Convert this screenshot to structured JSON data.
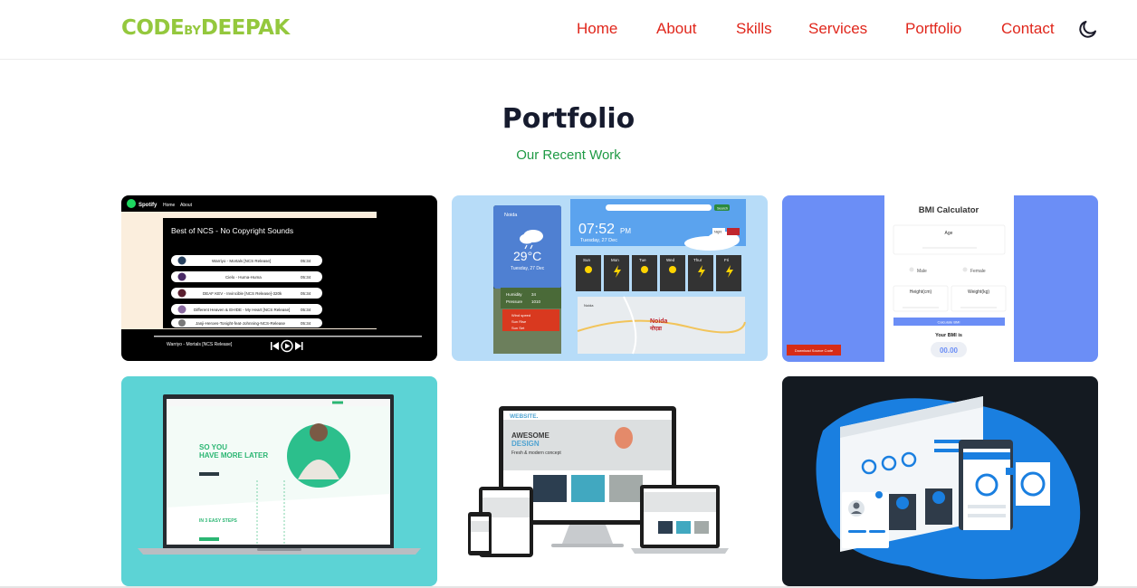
{
  "brand": {
    "code": "CODE",
    "by": "BY",
    "deepak": "DEEPAK"
  },
  "nav": [
    {
      "label": "Home"
    },
    {
      "label": "About"
    },
    {
      "label": "Skills"
    },
    {
      "label": "Services"
    },
    {
      "label": "Portfolio"
    },
    {
      "label": "Contact"
    }
  ],
  "theme_icon": "moon-icon",
  "section": {
    "title": "Portfolio",
    "subtitle": "Our Recent Work"
  },
  "colors": {
    "accent_green": "#94c83d",
    "nav_red": "#e0261b",
    "subtitle_green": "#1f9a45",
    "title": "#161b2e"
  },
  "projects": [
    {
      "name": "spotify-clone",
      "app": "Spotify",
      "menu": [
        "Home",
        "About"
      ],
      "playlist_title": "Best of NCS - No Copyright Sounds",
      "songs": [
        {
          "title": "Warriyo - Mortals [NCS Release]",
          "time": "05:34"
        },
        {
          "title": "Cielo - Huma-Huma",
          "time": "05:34"
        },
        {
          "title": "DEAF KEV - Invincible [NCS Release]-320k",
          "time": "05:34"
        },
        {
          "title": "Different Heaven & EH!DE - My Heart [NCS Release]",
          "time": "05:34"
        },
        {
          "title": "Janji-Heroes-Tonight-feat-Johnning-NCS-Release",
          "time": "05:34"
        }
      ],
      "now_playing": "Warriyo - Mortals [NCS Release]"
    },
    {
      "name": "weather-app",
      "location": "Noida",
      "temperature": "29°C",
      "date": "Tuesday, 27 Dec",
      "time": "07:52",
      "ampm": "PM",
      "days": [
        "Sun",
        "Mon",
        "Tue",
        "Wed",
        "Thur",
        "Fri"
      ],
      "humidity_label": "Humidity",
      "humidity_value": "34",
      "pressure_label": "Pressure",
      "pressure_value": "1010",
      "wind_label": "Wind speed",
      "sunrise_label": "Sun Rise",
      "sunset_label": "Sun Set",
      "search_label": "Search",
      "night_label": "Night",
      "map_label": "Noida",
      "map_label_local": "नोएडा"
    },
    {
      "name": "bmi-calculator",
      "title": "BMI Calculator",
      "age_label": "Age",
      "male_label": "Male",
      "female_label": "Female",
      "height_label": "Height(cm)",
      "weight_label": "Weight(kg)",
      "button_label": "Calculate BMI",
      "result_label": "Your BMI is",
      "result_value": "00.00",
      "download_label": "Download Source Code"
    },
    {
      "name": "landing-page-laptop",
      "headline_1": "SO YOU",
      "headline_2": "HAVE MORE LATER",
      "steps_label": "IN 3 EASY STEPS"
    },
    {
      "name": "responsive-website",
      "brand": "WEBSITE.",
      "headline_1": "AWESOME",
      "headline_2": "DESIGN",
      "tagline": "Fresh & modern concept"
    },
    {
      "name": "dashboard-illustration"
    }
  ]
}
